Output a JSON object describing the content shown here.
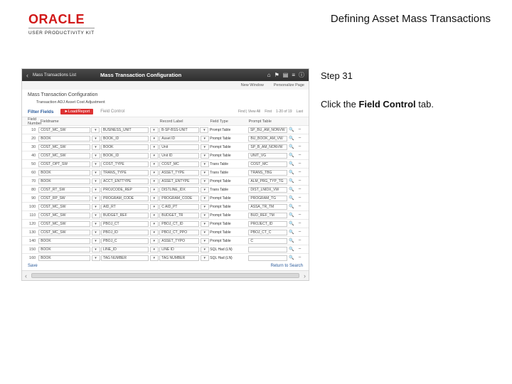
{
  "header": {
    "vendor_logo_text": "ORACLE",
    "vendor_sub": "USER PRODUCTIVITY KIT",
    "page_title": "Defining Asset Mass Transactions"
  },
  "instruction": {
    "step_label": "Step 31",
    "text_before": "Click the ",
    "text_bold": "Field Control",
    "text_after": " tab."
  },
  "shot": {
    "breadcrumb": "Mass Transactions List",
    "title": "Mass Transaction Configuration",
    "subbar_left": "New Window",
    "subbar_right": "Personalize Page",
    "section": "Mass Transaction Configuration",
    "transaction": "Transaction  ADJ   Asset Cost Adjustment",
    "tabs": {
      "label": "Filter Fields",
      "active": "►Load/Report",
      "other": "Field Control",
      "meta_find": "Find | View All",
      "meta_first": "First",
      "meta_range": "1-20 of 19",
      "meta_last": "Last"
    },
    "columns": {
      "num": "Field Number",
      "fieldname": "Fieldname",
      "reclabel": "Record Label",
      "fieldtype": "Field Type",
      "prompt": "Prompt Table"
    },
    "rows": [
      {
        "n": "10",
        "f": "COST_MC_SW",
        "nm": "BUSINESS_UNIT",
        "lbl": "B-SP-BSS-UNIT",
        "ft": "Prompt Table",
        "pt": "SP_BU_AM_NONVW"
      },
      {
        "n": "20",
        "f": "BOOK",
        "nm": "BOOK_ID",
        "lbl": "Asset ID",
        "ft": "Prompt Table",
        "pt": "BU_BOOK_AM_VW"
      },
      {
        "n": "30",
        "f": "COST_MC_SW",
        "nm": "BOOK",
        "lbl": "Unit",
        "ft": "Prompt Table",
        "pt": "SP_B_AM_NONVW"
      },
      {
        "n": "40",
        "f": "COST_MC_SW",
        "nm": "BOOK_ID",
        "lbl": "Unit ID",
        "ft": "Prompt Table",
        "pt": "UNIT_VG"
      },
      {
        "n": "50",
        "f": "COST_OPT_SW",
        "nm": "COST_TYPE",
        "lbl": "COST_MC",
        "ft": "Trans Table",
        "pt": "COST_MC"
      },
      {
        "n": "60",
        "f": "BOOK",
        "nm": "TRANS_TYPE",
        "lbl": "ASSET_TYPE",
        "ft": "Trans Table",
        "pt": "TRANS_TBG"
      },
      {
        "n": "70",
        "f": "BOOK",
        "nm": "ACCT_ENTTYPE",
        "lbl": "ASSET_ENTYPE",
        "ft": "Prompt Table",
        "pt": "ALM_PRG_TYP_TG"
      },
      {
        "n": "80",
        "f": "COST_RT_SW",
        "nm": "PROJCODE_REP",
        "lbl": "DISTLINE_IDX",
        "ft": "Trans Table",
        "pt": "DIST_LNIDX_VW"
      },
      {
        "n": "90",
        "f": "COST_RP_SW",
        "nm": "PROGRAM_CODE",
        "lbl": "PROGRAM_CODE",
        "ft": "Prompt Table",
        "pt": "PROGRAM_TG"
      },
      {
        "n": "100",
        "f": "COST_MC_SW",
        "nm": "AID_RT",
        "lbl": "C AID_PT",
        "ft": "Prompt Table",
        "pt": "ASSA_TR_TM"
      },
      {
        "n": "110",
        "f": "COST_MC_SW",
        "nm": "BUDGET_REF",
        "lbl": "BUDGET_TR",
        "ft": "Prompt Table",
        "pt": "BUD_REF_TM"
      },
      {
        "n": "120",
        "f": "COST_MC_SW",
        "nm": "PBOJ_CT",
        "lbl": "PBOJ_CT_ID",
        "ft": "Prompt Table",
        "pt": "PROJECT_ID"
      },
      {
        "n": "130",
        "f": "COST_MC_SW",
        "nm": "PBOJ_ID",
        "lbl": "PBOJ_CT_PPO",
        "ft": "Prompt Table",
        "pt": "PBOJ_CT_C"
      },
      {
        "n": "140",
        "f": "BOOK",
        "nm": "PBOJ_C",
        "lbl": "ASSET_TYPO",
        "ft": "Prompt Table",
        "pt": "C"
      },
      {
        "n": "150",
        "f": "BOOK",
        "nm": "LINE_ID",
        "lbl": "LINE ID",
        "ft": "SQL Had (LN)",
        "pt": ""
      },
      {
        "n": "160",
        "f": "BOOK",
        "nm": "TAG NUMBER",
        "lbl": "TAG NUMBER",
        "ft": "SQL Had (LN)",
        "pt": ""
      }
    ],
    "footer_left": "Save",
    "footer_right": "Return to Search"
  }
}
